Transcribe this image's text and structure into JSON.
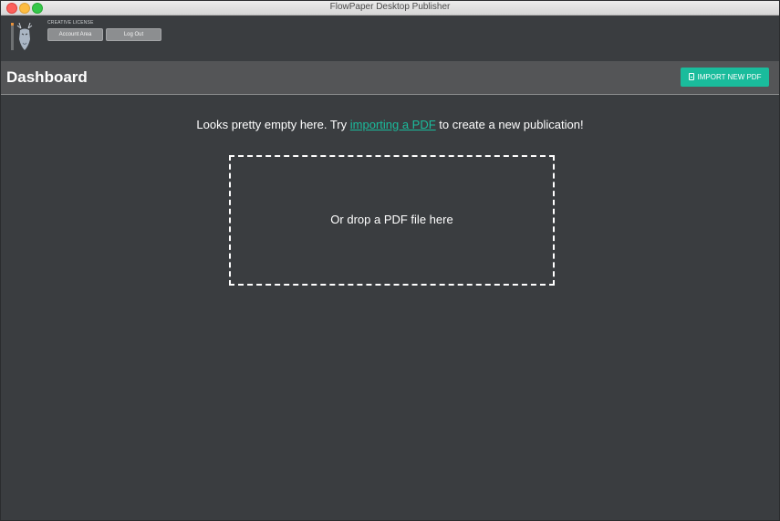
{
  "window": {
    "title": "FlowPaper Desktop Publisher"
  },
  "topbar": {
    "logo_icon": "flowpaper-stag-logo",
    "license_label": "CREATIVE LICENSE",
    "account_button": "Account Area",
    "logout_button": "Log Out"
  },
  "dashboard": {
    "title": "Dashboard",
    "import_button": "IMPORT NEW PDF",
    "import_icon": "file-icon",
    "accent_color": "#1abc9c"
  },
  "main": {
    "empty_prefix": "Looks pretty empty here. Try ",
    "empty_link": "importing a PDF",
    "empty_suffix": " to create a new publication!",
    "dropzone_text": "Or drop a PDF file here"
  }
}
